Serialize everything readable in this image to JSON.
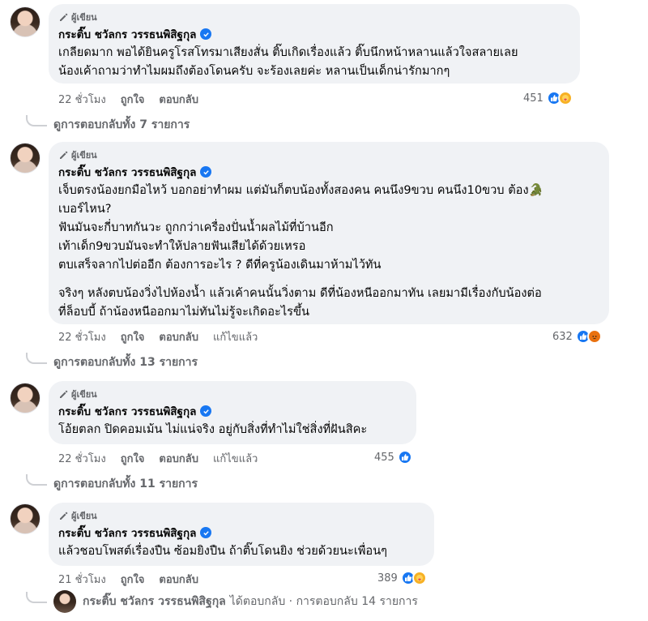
{
  "comments": [
    {
      "author_tag": "ผู้เขียน",
      "name": "กระติ๊บ ชวัลกร วรรธนพิสิฐกุล",
      "lines": [
        "เกลียดมาก พอได้ยินครูโรสโทรมาเสียงสั่น ติ๊บเกิดเรื่องแล้ว ติ๊บนึกหน้าหลานแล้วใจสลายเลย",
        "น้องเค้าถามว่าทำไมผมถึงต้องโดนครับ จะร้องเลยค่ะ หลานเป็นเด็กน่ารักมากๆ"
      ],
      "time": "22 ชั่วโมง",
      "like": "ถูกใจ",
      "reply": "ตอบกลับ",
      "edited": "",
      "reaction_count": "451",
      "reactions": [
        "like",
        "care"
      ],
      "replies_label": "ดูการตอบกลับทั้ง 7 รายการ"
    },
    {
      "author_tag": "ผู้เขียน",
      "name": "กระติ๊บ ชวัลกร วรรธนพิสิฐกุล",
      "lines": [
        "เจ็บตรงน้องยกมือไหว้ บอกอย่าทำผม แต่มันก็ตบน้องทั้งสองคน คนนึง9ขวบ คนนึง10ขวบ ต้อง🐊",
        "เบอร์ไหน?",
        "ฟันมันจะกี่บาทกันวะ ถูกกว่าเครื่องปั่นน้ำผลไม้ที่บ้านอีก",
        "เท้าเด็ก9ขวบมันจะทำให้ปลายฟันเสียได้ด้วยเหรอ",
        "ตบเสร็จลากไปต่ออีก ต้องการอะไร ? ดีที่ครูน้องเดินมาห้ามไว้ทัน",
        "",
        "จริงๆ หลังตบน้องวิ่งไปห้องน้ำ แล้วเค้าคนนั้นวิ่งตาม ดีที่น้องหนีออกมาทัน เลยมามีเรื่องกับน้องต่อ",
        "ที่ล็อบบี้ ถ้าน้องหนีออกมาไม่ทันไม่รู้จะเกิดอะไรขึ้น"
      ],
      "time": "22 ชั่วโมง",
      "like": "ถูกใจ",
      "reply": "ตอบกลับ",
      "edited": "แก้ไขแล้ว",
      "reaction_count": "632",
      "reactions": [
        "like",
        "angry"
      ],
      "replies_label": "ดูการตอบกลับทั้ง 13 รายการ"
    },
    {
      "author_tag": "ผู้เขียน",
      "name": "กระติ๊บ ชวัลกร วรรธนพิสิฐกุล",
      "lines": [
        "โอ้ยตลก ปิดคอมเม้น ไม่แน่จริง อยู่กับสิ่งที่ทำไม่ใช่สิ่งที่ฝันสิคะ"
      ],
      "time": "22 ชั่วโมง",
      "like": "ถูกใจ",
      "reply": "ตอบกลับ",
      "edited": "แก้ไขแล้ว",
      "reaction_count": "455",
      "reactions": [
        "like"
      ],
      "replies_label": "ดูการตอบกลับทั้ง 11 รายการ"
    },
    {
      "author_tag": "ผู้เขียน",
      "name": "กระติ๊บ ชวัลกร วรรธนพิสิฐกุล",
      "lines": [
        "แล้วชอบโพสต์เรื่องปืน ซ้อมยิงปืน ถ้าติ๊บโดนยิง ช่วยด้วยนะเพื่อนๆ"
      ],
      "time": "21 ชั่วโมง",
      "like": "ถูกใจ",
      "reply": "ตอบกลับ",
      "edited": "",
      "reaction_count": "389",
      "reactions": [
        "like",
        "care"
      ]
    }
  ],
  "last_reply": {
    "name": "กระติ๊บ ชวัลกร วรรธนพิสิฐกุล",
    "text": "ได้ตอบกลับ · การตอบกลับ 14 รายการ"
  },
  "colors": {
    "verified": "#1877f2",
    "bubble": "#f0f2f5",
    "meta": "#65676b"
  }
}
